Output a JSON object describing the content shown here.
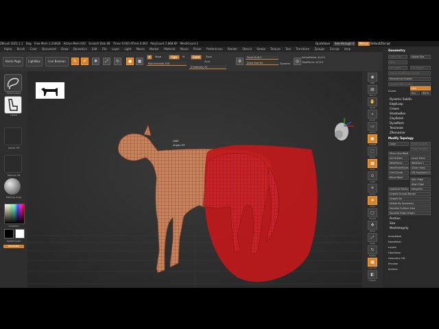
{
  "titlebar": {
    "items": [
      "ZBrush 2021.1.1",
      "Dog",
      "Free Mem 1.234GB",
      "Active Mem 620",
      "Scratch Disk 48",
      "Timer 0.005 ATime 0.003",
      "PolyCount 7.868 KP",
      "MeshCount 1"
    ],
    "quicksave": "QuickSave",
    "seethrough": "See-through 0",
    "menus": "Menus",
    "script": "DefaultZScript"
  },
  "menubar": {
    "items": [
      "Alpha",
      "Brush",
      "Color",
      "Document",
      "Draw",
      "Dynamics",
      "Edit",
      "File",
      "Layer",
      "Light",
      "Macro",
      "Marker",
      "Material",
      "Movie",
      "Picker",
      "Preferences",
      "Render",
      "Stencil",
      "Stroke",
      "Texture",
      "Tool",
      "Transform",
      "Zplugin",
      "Zscript",
      "Help"
    ]
  },
  "toolbar": {
    "home": "Home Page",
    "lightbox": "LightBox",
    "livebool": "Live Boolean",
    "a_label": "A",
    "mrgb": "Mrgb",
    "rgb": "Rgb",
    "m": "M",
    "zadd": "Zadd",
    "zsub": "Zsub",
    "zcut": "Zcut",
    "rgb_intensity": "Rgb Intensity 100",
    "z_intensity": "Z Intensity 25",
    "focal_shift": "Focal Shift 0",
    "draw_size": "Draw Size 64",
    "dynamic": "Dynamic",
    "active_points": "ActivePoints: 8,013",
    "total_points": "TotalPoints: 8,013"
  },
  "leftpanel": {
    "tile1": "SelectLasso",
    "tile2": "Lasso",
    "alpha": "Alpha Off",
    "texture": "Texture Off",
    "material": "MatCap Gray",
    "gradient": "Gradient",
    "switch": "SwitchColor",
    "alternate": "Alternate"
  },
  "viewport": {
    "hud1": "HIDE",
    "hud2": "Angle=93"
  },
  "rightdock": {
    "labels": [
      "BPR",
      "SPix 3",
      "Scroll",
      "Zoom",
      "Actual",
      "AAHalf",
      "Persp",
      "Floor",
      "Local",
      "Gizmo",
      "Qxyz",
      "Frame",
      "Move",
      "Scale",
      "Rotate",
      "Line Fill",
      "PolyF",
      "Transp",
      "Ghost",
      "Solo",
      "Xpose"
    ]
  },
  "palette": {
    "title": "Geometry",
    "lower_res": "Lower Res",
    "higher_res": "Higher Res",
    "sdiv": "SDiv",
    "del_lower": "Del Lower",
    "del_higher": "Del Higher",
    "freeze": "Freeze SubDivision Levels",
    "reconstruct": "Reconstruct Subdiv",
    "convert": "Convert BPR To Geo",
    "divide": "Divide",
    "smt": "Smt",
    "suv": "Suv",
    "reuv": "ReUV",
    "items1": [
      "Dynamic Subdiv",
      "EdgeLoop",
      "Crease",
      "ShadowBox",
      "ClayPolish",
      "DynaMesh",
      "Tessimate",
      "ZRemesher"
    ],
    "modify": "Modify Topology",
    "copy": "Copy",
    "paste_append": "Paste Append",
    "paste_replace": "Paste Replace",
    "mirror_weld": "Mirror And Weld",
    "del_hidden": "Del Hidden",
    "insert_mesh": "Insert Mesh",
    "weld_points": "WeldPoints",
    "weld_dist": "WeldDist 1",
    "mesh_from_brush": "MeshFromBrush",
    "close_holes": "Close Holes",
    "grid_divide": "Grid Divide",
    "gd_segments": "GD Segments 3",
    "micro_mesh": "Micro Mesh",
    "spin_edge": "Spin Edge",
    "align_edge": "Align Edge",
    "optimize_points": "Optimize Points",
    "merge_tris": "MergeTris",
    "unweld_groups": "Unweld Groups Border",
    "unweld_all": "Unweld All",
    "delete_symmetry": "Delete By Symmetry",
    "equalize_surface": "Equalize Surface Area",
    "equalize_edge": "Equalize Edge Length",
    "items2": [
      "Position",
      "Size",
      "MeshIntegrity"
    ],
    "items3": [
      "ArrayMesh",
      "NanoMesh",
      "Layers",
      "FiberMesh",
      "Geometry HD",
      "Preview",
      "Surface"
    ]
  },
  "colors": {
    "accent": "#d9822b",
    "mask_red": "#c0181a",
    "background": "#2d2d2d"
  }
}
